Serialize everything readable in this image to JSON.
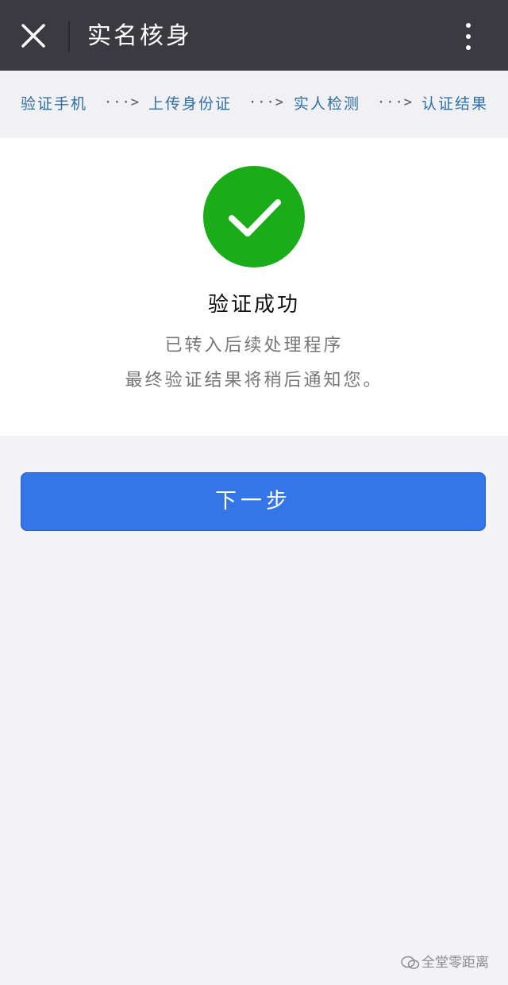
{
  "header": {
    "title": "实名核身",
    "close_icon": "close-icon",
    "more_icon": "more-vertical-icon"
  },
  "steps": [
    {
      "label": "验证手机"
    },
    {
      "label": "上传身份证"
    },
    {
      "label": "实人检测"
    },
    {
      "label": "认证结果"
    }
  ],
  "step_separator": "···>",
  "result": {
    "icon": "success-check-icon",
    "title": "验证成功",
    "line1": "已转入后续处理程序",
    "line2": "最终验证结果将稍后通知您。"
  },
  "actions": {
    "next_label": "下一步"
  },
  "watermark": {
    "text": "全堂零距离"
  },
  "colors": {
    "topbar": "#3a3a40",
    "step_text": "#2f6ea8",
    "success": "#1aad19",
    "primary_button": "#3476e8",
    "page_bg": "#f3f2f7"
  }
}
